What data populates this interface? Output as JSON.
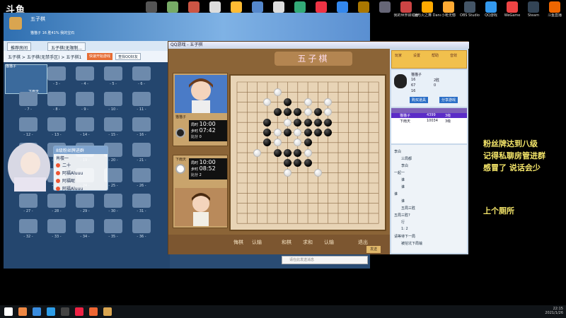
{
  "stream": {
    "logo": "斗鱼",
    "side_text": [
      "粉丝牌达到八级",
      "记得私聊房管进群",
      "感冒了  说话会少",
      "上个厕所"
    ]
  },
  "desktop_icons": [
    "",
    "",
    "",
    "",
    "",
    "",
    "",
    "",
    "",
    "",
    "",
    "",
    "我的世界启动器",
    "冰与火之舞 Dance of F...",
    "小枪无憾",
    "OBS Studio",
    "QQ游戏",
    "WeGame",
    "Steam",
    "斗鱼直播"
  ],
  "lobby": {
    "title": "五子棋",
    "stats": "猫猫子  16  胜41%  我的宝石",
    "tabs": [
      "推荐房间",
      "五子棋(无限制..."
    ],
    "breadcrumb": "五子棋 > 五子棋(无禁手区) > 五子棋1",
    "btn_quick": "快速开始游戏",
    "btn_search": "查找QQ好友",
    "player_top_name": "猫猫子",
    "player_bottom_name": "下雨天",
    "table_labels": [
      "- 3 -",
      "- 4 -",
      "- 5 -",
      "- 6 -",
      "- 7 -",
      "- 8 -",
      "- 9 -",
      "- 10 -",
      "- 11 -",
      "- 12 -",
      "- 13 -",
      "- 14 -",
      "- 15 -",
      "- 16 -",
      "- 17 -",
      "- 18 -",
      "- 19 -",
      "- 20 -",
      "- 21 -",
      "- 22 -",
      "- 23 -",
      "- 24 -",
      "- 25 -",
      "- 26 -",
      "- 27 -",
      "- 28 -",
      "- 29 -",
      "- 30 -",
      "- 31 -",
      "- 32 -",
      "- 33 -",
      "- 34 -",
      "- 35 -",
      "- 36 -"
    ]
  },
  "fan_card": {
    "header": "8级粉丝牌进群",
    "name": "肖楼一",
    "rows": [
      "二十",
      "阿福Aluuu",
      "阿福呢",
      "阿福Aluuu"
    ]
  },
  "game": {
    "title": "QQ游戏 - 五子棋",
    "banner": "五子棋",
    "player1": {
      "name": "猫猫子",
      "total_time": "10:00",
      "step_time": "07:42",
      "score": "比分 0"
    },
    "player2": {
      "name": "下雨天",
      "total_time": "10:00",
      "step_time": "08:52",
      "score": "比分 2"
    },
    "labels": {
      "total": "局时",
      "step": "步时"
    },
    "buttons": [
      "悔棋",
      "认输",
      "和棋",
      "求和",
      "认输",
      "退出"
    ],
    "send_btn": "发送",
    "right_tabs": [
      "玩家",
      "设置",
      "帮助",
      "音效"
    ],
    "info": {
      "name": "猫猫子",
      "level": "16",
      "score": "2胜",
      "total": "67",
      "rate": "0",
      "points": "16"
    },
    "btn_buy": "购买道具",
    "btn_share": "分享游戏",
    "players_list": [
      {
        "name": "猫猫子",
        "rank": "4399",
        "games": "3级"
      },
      {
        "name": "下雨天",
        "rank": "10034",
        "games": "3级"
      }
    ],
    "chat": [
      "李白",
      "三局都",
      "李白",
      "一起一",
      "谁",
      "谁",
      "谁",
      "谁",
      "五局三胜",
      "五局三胜?",
      "行",
      "1: 2",
      "请等待下一局",
      "被挖坑下局输"
    ],
    "input_placeholder": "请在此发送消息"
  },
  "taskbar": {
    "time": "22:15",
    "date": "2021/1/26"
  }
}
